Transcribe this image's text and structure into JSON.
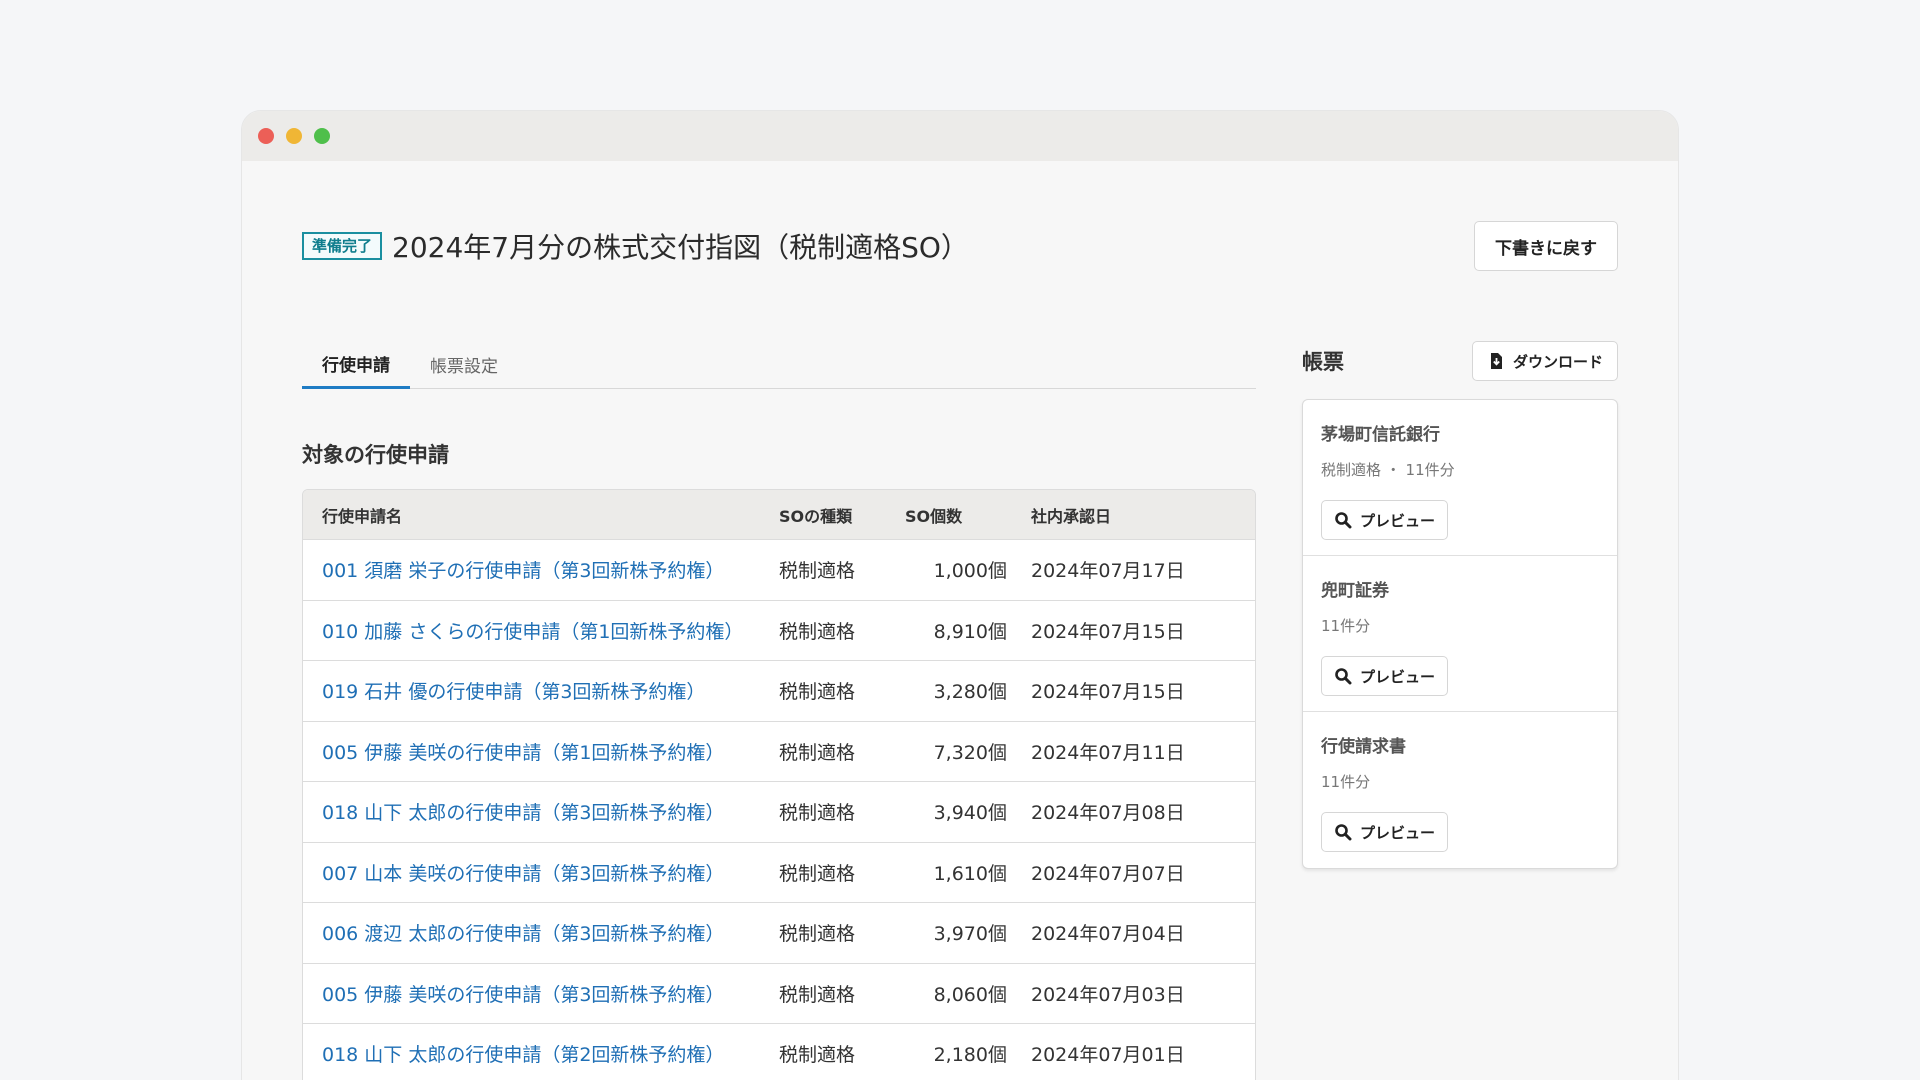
{
  "header": {
    "status_badge": "準備完了",
    "title": "2024年7月分の株式交付指図（税制適格SO）",
    "revert_button": "下書きに戻す"
  },
  "tabs": [
    {
      "label": "行使申請",
      "active": true
    },
    {
      "label": "帳票設定",
      "active": false
    }
  ],
  "section_title": "対象の行使申請",
  "table": {
    "headers": [
      "行使申請名",
      "SOの種類",
      "SO個数",
      "社内承認日"
    ],
    "rows": [
      {
        "name": "001 須磨 栄子の行使申請（第3回新株予約権）",
        "type": "税制適格",
        "count": "1,000個",
        "date": "2024年07月17日"
      },
      {
        "name": "010 加藤 さくらの行使申請（第1回新株予約権）",
        "type": "税制適格",
        "count": "8,910個",
        "date": "2024年07月15日"
      },
      {
        "name": "019 石井 優の行使申請（第3回新株予約権）",
        "type": "税制適格",
        "count": "3,280個",
        "date": "2024年07月15日"
      },
      {
        "name": "005 伊藤 美咲の行使申請（第1回新株予約権）",
        "type": "税制適格",
        "count": "7,320個",
        "date": "2024年07月11日"
      },
      {
        "name": "018 山下 太郎の行使申請（第3回新株予約権）",
        "type": "税制適格",
        "count": "3,940個",
        "date": "2024年07月08日"
      },
      {
        "name": "007 山本 美咲の行使申請（第3回新株予約権）",
        "type": "税制適格",
        "count": "1,610個",
        "date": "2024年07月07日"
      },
      {
        "name": "006 渡辺 太郎の行使申請（第3回新株予約権）",
        "type": "税制適格",
        "count": "3,970個",
        "date": "2024年07月04日"
      },
      {
        "name": "005 伊藤 美咲の行使申請（第3回新株予約権）",
        "type": "税制適格",
        "count": "8,060個",
        "date": "2024年07月03日"
      },
      {
        "name": "018 山下 太郎の行使申請（第2回新株予約権）",
        "type": "税制適格",
        "count": "2,180個",
        "date": "2024年07月01日"
      }
    ]
  },
  "documents": {
    "title": "帳票",
    "download_button": "ダウンロード",
    "items": [
      {
        "name": "茅場町信託銀行",
        "meta": "税制適格 ・ 11件分",
        "preview_label": "プレビュー"
      },
      {
        "name": "兜町証券",
        "meta": "11件分",
        "preview_label": "プレビュー"
      },
      {
        "name": "行使請求書",
        "meta": "11件分",
        "preview_label": "プレビュー"
      }
    ]
  },
  "colors": {
    "accent": "#1f7cc4",
    "link": "#1f6fb5",
    "badge": "#1a8fa0"
  },
  "icons": {
    "download": "file-download-icon",
    "preview": "magnifier-icon"
  }
}
